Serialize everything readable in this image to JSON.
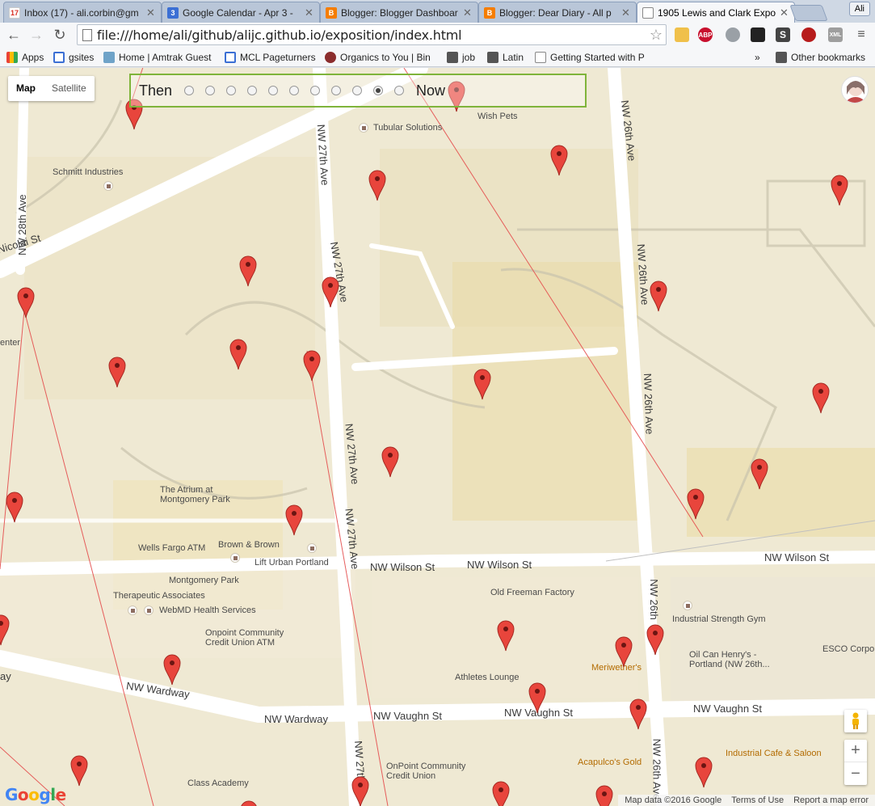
{
  "tabs": [
    {
      "label": "Inbox (17) - ali.corbin@gm",
      "icon": "gmail-icon",
      "badge": "17",
      "color": "#d93025"
    },
    {
      "label": "Google Calendar - Apr 3 -",
      "icon": "calendar-icon",
      "badge": "3",
      "color": "#3b6fd4"
    },
    {
      "label": "Blogger: Blogger Dashboar",
      "icon": "blogger-icon",
      "badge": "B",
      "color": "#f57d00"
    },
    {
      "label": "Blogger: Dear Diary - All p",
      "icon": "blogger-icon",
      "badge": "B",
      "color": "#f57d00"
    },
    {
      "label": "1905 Lewis and Clark Expo",
      "icon": "page-icon",
      "badge": "",
      "color": "#ffffff"
    }
  ],
  "profile": "Ali",
  "url": "file:///home/ali/github/alijc.github.io/exposition/index.html",
  "extensions": [
    {
      "name": "notes-extension-icon",
      "label": "",
      "color": "#f0c04a"
    },
    {
      "name": "adblock-icon",
      "label": "ABP",
      "color": "#c8102e"
    },
    {
      "name": "search-extension-icon",
      "label": "",
      "color": "#9aa0a6"
    },
    {
      "name": "ghost-extension-icon",
      "label": "",
      "color": "#222222"
    },
    {
      "name": "s-extension-icon",
      "label": "S",
      "color": "#444444"
    },
    {
      "name": "car-extension-icon",
      "label": "",
      "color": "#b71c1c"
    },
    {
      "name": "xml-extension-icon",
      "label": "XML",
      "color": "#9e9e9e"
    }
  ],
  "bookmarks": [
    {
      "label": "Apps",
      "icon": "apps-icon",
      "color": "#4285f4"
    },
    {
      "label": "gsites",
      "icon": "gsites-icon",
      "color": "#3b6fd4"
    },
    {
      "label": "Home | Amtrak Guest",
      "icon": "amtrak-icon",
      "color": "#6fa3c8"
    },
    {
      "label": "MCL Pageturners",
      "icon": "mcl-icon",
      "color": "#3b6fd4"
    },
    {
      "label": "Organics to You | Bin",
      "icon": "organics-icon",
      "color": "#8b2d2d"
    },
    {
      "label": "job",
      "icon": "folder-icon",
      "color": "#555555"
    },
    {
      "label": "Latin",
      "icon": "folder-icon",
      "color": "#555555"
    },
    {
      "label": "Getting Started with P",
      "icon": "page-icon",
      "color": "#ffffff"
    }
  ],
  "bookmarks_more": "»",
  "other_bookmarks": "Other bookmarks",
  "map": {
    "type_map": "Map",
    "type_satellite": "Satellite",
    "slider_then": "Then",
    "slider_now": "Now",
    "slider_stops": 11,
    "slider_selected": 9,
    "streets": [
      {
        "text": "NW 28th Ave",
        "rot": -90
      },
      {
        "text": "Nicolai St",
        "rot": -16
      },
      {
        "text": "NW 27th Ave",
        "rot": 86
      },
      {
        "text": "NW 27th Ave",
        "rot": 80
      },
      {
        "text": "NW 26th Ave",
        "rot": 83
      },
      {
        "text": "NW 26th Ave",
        "rot": 86
      },
      {
        "text": "NW 26th Ave",
        "rot": 88
      },
      {
        "text": "NW 27th Ave",
        "rot": 84
      },
      {
        "text": "NW 27th Ave",
        "rot": 84
      },
      {
        "text": "NW Wilson St",
        "rot": -1
      },
      {
        "text": "NW Wilson St",
        "rot": -1
      },
      {
        "text": "NW Wilson St",
        "rot": -1
      },
      {
        "text": "NW Wardway",
        "rot": 8
      },
      {
        "text": "NW Wardway",
        "rot": 0
      },
      {
        "text": "NW Vaughn St",
        "rot": -1
      },
      {
        "text": "NW Vaughn St",
        "rot": -1
      },
      {
        "text": "NW Vaughn St",
        "rot": -1
      },
      {
        "text": "NW 27th",
        "rot": 86
      },
      {
        "text": "NW 26th",
        "rot": 90
      },
      {
        "text": "NW 26th Ave",
        "rot": 90
      },
      {
        "text": "ay",
        "rot": 0
      },
      {
        "text": "enter",
        "rot": 0
      }
    ],
    "places": [
      "Tubular Solutions",
      "Wish Pets",
      "Schmitt Industries",
      "The Atrium at Montgomery Park",
      "Wells Fargo ATM",
      "Brown & Brown",
      "Lift Urban Portland",
      "Montgomery Park",
      "Therapeutic Associates",
      "WebMD Health Services",
      "Onpoint Community Credit Union ATM",
      "Old Freeman Factory",
      "Industrial Strength Gym",
      "Oil Can Henry's - Portland (NW 26th...",
      "ESCO Corpora",
      "Meriwether's",
      "Athletes Lounge",
      "OnPoint Community Credit Union",
      "Acapulco's Gold",
      "Industrial Cafe & Saloon",
      "Class Academy"
    ],
    "attribution": [
      "Map data ©2016 Google",
      "Terms of Use",
      "Report a map error"
    ],
    "logo": "Google",
    "zoom_in": "+",
    "zoom_out": "−"
  }
}
